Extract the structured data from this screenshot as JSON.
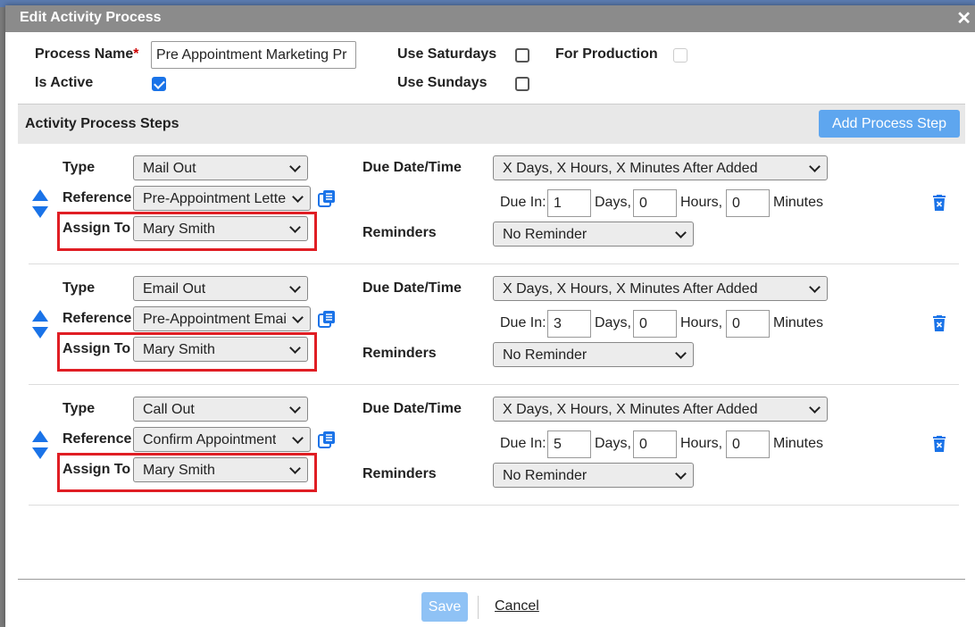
{
  "dialog": {
    "title": "Edit Activity Process",
    "close_glyph": "✕"
  },
  "form": {
    "process_name_label": "Process Name",
    "required_mark": "*",
    "process_name_value": "Pre Appointment Marketing Pr",
    "is_active_label": "Is Active",
    "is_active": true,
    "use_saturdays_label": "Use Saturdays",
    "use_saturdays": false,
    "use_sundays_label": "Use Sundays",
    "use_sundays": false,
    "for_production_label": "For Production",
    "for_production": false
  },
  "steps_section": {
    "title": "Activity Process Steps",
    "add_button": "Add Process Step"
  },
  "labels": {
    "type": "Type",
    "reference": "Reference",
    "assign_to": "Assign To",
    "due_date_time": "Due Date/Time",
    "reminders": "Reminders",
    "due_in": "Due In:",
    "days": "Days,",
    "hours": "Hours,",
    "minutes": "Minutes"
  },
  "steps": [
    {
      "type": "Mail Out",
      "reference": "Pre-Appointment Lette",
      "assign_to": "Mary Smith",
      "due_rule": "X Days, X Hours, X Minutes After Added",
      "days": "1",
      "hours": "0",
      "minutes": "0",
      "reminder": "No Reminder"
    },
    {
      "type": "Email Out",
      "reference": "Pre-Appointment Emai",
      "assign_to": "Mary Smith",
      "due_rule": "X Days, X Hours, X Minutes After Added",
      "days": "3",
      "hours": "0",
      "minutes": "0",
      "reminder": "No Reminder"
    },
    {
      "type": "Call Out",
      "reference": "Confirm Appointment",
      "assign_to": "Mary Smith",
      "due_rule": "X Days, X Hours, X Minutes After Added",
      "days": "5",
      "hours": "0",
      "minutes": "0",
      "reminder": "No Reminder"
    }
  ],
  "footer": {
    "save": "Save",
    "cancel": "Cancel"
  },
  "colors": {
    "accent": "#5ea6ef",
    "highlight": "#e01e24",
    "checkbox_checked": "#1a73e8",
    "titlebar": "#8b8b8b"
  }
}
